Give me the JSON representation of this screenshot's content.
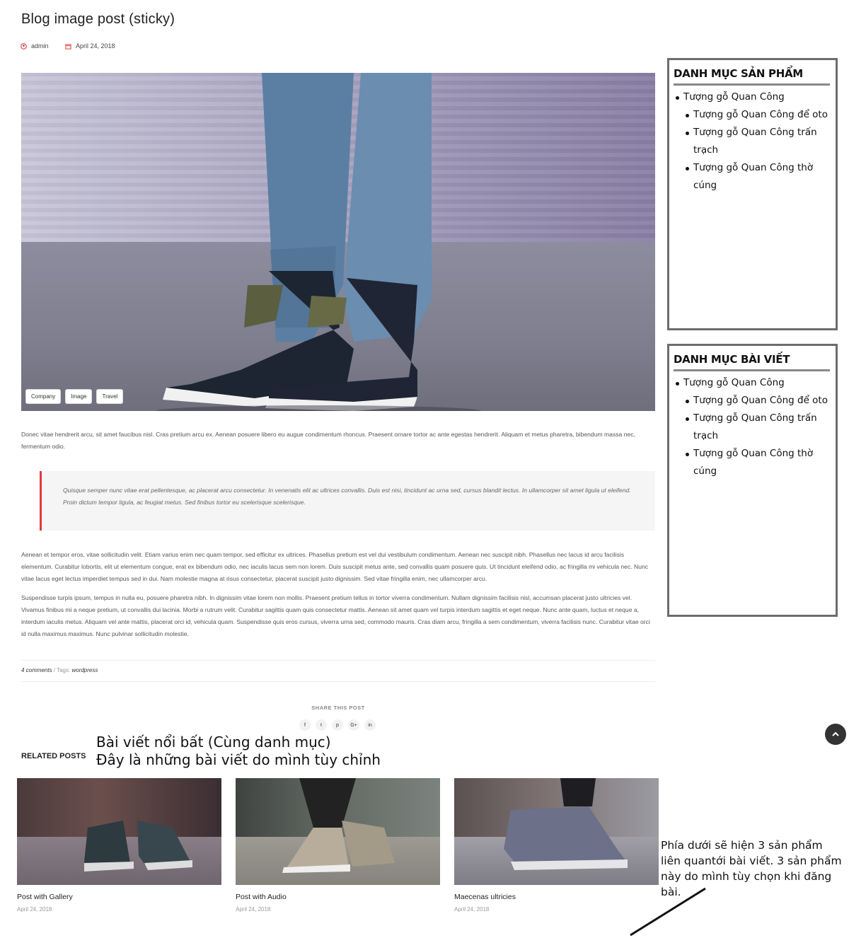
{
  "post": {
    "title": "Blog image post (sticky)",
    "author": "admin",
    "date": "April 24, 2018",
    "tags_on_image": [
      "Company",
      "Image",
      "Travel"
    ],
    "paragraph1": "Donec vitae hendrerit arcu, sit amet faucibus nisl. Cras pretium arcu ex. Aenean posuere libero eu augue condimentum rhoncus. Praesent ornare tortor ac ante egestas hendrerit. Aliquam et metus pharetra, bibendum massa nec, fermentum odio.",
    "quote": "Quisque semper nunc vitae erat pellentesque, ac placerat arcu consectetur. In venenatis elit ac ultrices convallis. Duis est nisi, tincidunt ac urna sed, cursus blandit lectus. In ullamcorper sit amet ligula ut eleifend. Proin dictum tempor ligula, ac feugiat metus. Sed finibus tortor eu scelerisque scelerisque.",
    "paragraph2": "Aenean et tempor eros, vitae sollicitudin velit. Etiam varius enim nec quam tempor, sed efficitur ex ultrices. Phasellus pretium est vel dui vestibulum condimentum. Aenean nec suscipit nibh. Phasellus nec lacus id arcu facilisis elementum. Curabitur lobortis, elit ut elementum congue, erat ex bibendum odio, nec iaculis lacus sem non lorem. Duis suscipit metus ante, sed convallis quam posuere quis. Ut tincidunt eleifend odio, ac fringilla mi vehicula nec. Nunc vitae lacus eget lectus imperdiet tempus sed in dui. Nam molestie magna at risus consectetur, placerat suscipit justo dignissim. Sed vitae fringilla enim, nec ullamcorper arcu.",
    "paragraph3": "Suspendisse turpis ipsum, tempus in nulla eu, posuere pharetra nibh. In dignissim vitae lorem non mollis. Praesent pretium tellus in tortor viverra condimentum. Nullam dignissim facilisis nisl, accumsan placerat justo ultricies vel. Vivamus finibus mi a neque pretium, ut convallis dui lacinia. Morbi a rutrum velit. Curabitur sagittis quam quis consectetur mattis. Aenean sit amet quam vel turpis interdum sagittis et eget neque. Nunc ante quam, luctus et neque a, interdum iaculis metus. Aliquam vel ante mattis, placerat orci id, vehicula quam. Suspendisse quis eros cursus, viverra urna sed, commodo mauris. Cras diam arcu, fringilla a sem condimentum, viverra facilisis nunc. Curabitur vitae orci id nulla maximus maximus. Nunc pulvinar sollicitudin molestie.",
    "comments": "4 comments",
    "separator": " / ",
    "tags_label": "Tags:",
    "tag": "wordpress"
  },
  "share": {
    "title": "SHARE THIS POST",
    "icons": [
      "f",
      "t",
      "p",
      "G+",
      "in"
    ]
  },
  "related": {
    "heading": "RELATED POSTS",
    "items": [
      {
        "title": "Post with Gallery",
        "date": "April 24, 2018"
      },
      {
        "title": "Post with Audio",
        "date": "April 24, 2018"
      },
      {
        "title": "Maecenas ultricies",
        "date": "April 24, 2018"
      }
    ]
  },
  "annotations": {
    "featured_line1": "Bài viết nổi bất (Cùng danh mục)",
    "featured_line2": "Đây là những bài viết do mình tùy chỉnh",
    "products_line1": "Phía dưới sẽ hiện 3 sản phẩm",
    "products_line2": "liên quantới bài viết. 3 sản phẩm",
    "products_line3": "này do mình tùy chọn khi đăng bài."
  },
  "sidebar": {
    "product_categories": {
      "title": "DANH MỤC SẢN PHẨM",
      "parent": "Tượng gỗ Quan Công",
      "children": [
        "Tượng gỗ Quan Công để oto",
        "Tượng gỗ Quan Công trấn trạch",
        "Tượng gỗ Quan Công thờ cúng"
      ]
    },
    "post_categories": {
      "title": "DANH MỤC BÀI VIẾT",
      "parent": "Tượng gỗ Quan Công",
      "children": [
        "Tượng gỗ Quan Công để oto",
        "Tượng gỗ Quan Công trấn trạch",
        "Tượng gỗ Quan Công thờ cúng"
      ]
    }
  },
  "colors": {
    "accent": "#e03a3a",
    "sidebar_border": "#6d6d6d"
  }
}
